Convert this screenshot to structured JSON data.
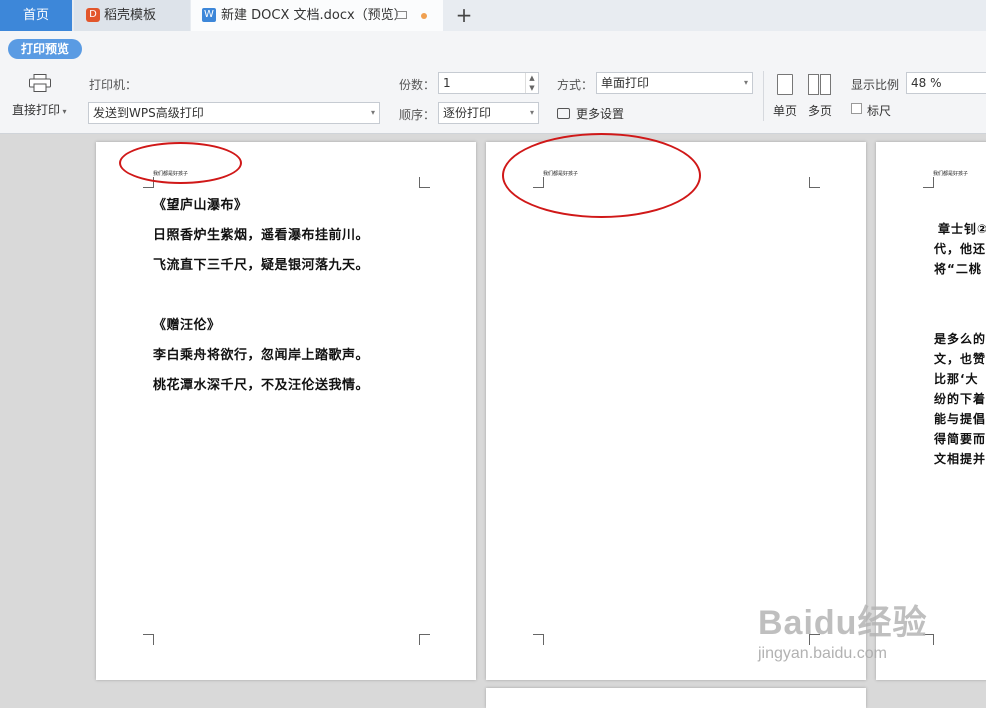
{
  "tabs": [
    {
      "label": "首页"
    },
    {
      "label": "稻壳模板"
    },
    {
      "label": "新建 DOCX 文档.docx（预览）"
    }
  ],
  "toolbar": {
    "mode_badge": "打印预览",
    "direct_print": "直接打印",
    "printer_label": "打印机：",
    "printer_value": "发送到WPS高级打印",
    "copies_label": "份数：",
    "copies_value": "1",
    "order_label": "顺序：",
    "order_value": "逐份打印",
    "method_label": "方式：",
    "method_value": "单面打印",
    "more_settings": "更多设置",
    "single_page": "单页",
    "multi_page": "多页",
    "zoom_label": "显示比例",
    "zoom_value": "48 %",
    "ruler_label": "标尺"
  },
  "page1": {
    "header": "我们都是好孩子",
    "title1": "《望庐山瀑布》",
    "line1": "日照香炉生紫烟，遥看瀑布挂前川。",
    "line2": "飞流直下三千尺，疑是银河落九天。",
    "title2": "《赠汪伦》",
    "line3": "李白乘舟将欲行，忽闻岸上踏歌声。",
    "line4": "桃花潭水深千尺，不及汪伦送我情。"
  },
  "page2": {
    "header": "我们都是好孩子"
  },
  "page3": {
    "header": "我们都是好孩子",
    "lines": [
      "章士钊②",
      "代，他还",
      "将“二桃",
      "是多么的",
      "文，也赞",
      "比那‘大",
      "纷的下着",
      "能与提倡",
      "得简要而",
      "文相提并"
    ]
  },
  "watermark": {
    "logo": "Baidu经验",
    "url": "jingyan.baidu.com"
  },
  "colors": {
    "accent": "#3d87d9",
    "annotation": "#d01818"
  }
}
